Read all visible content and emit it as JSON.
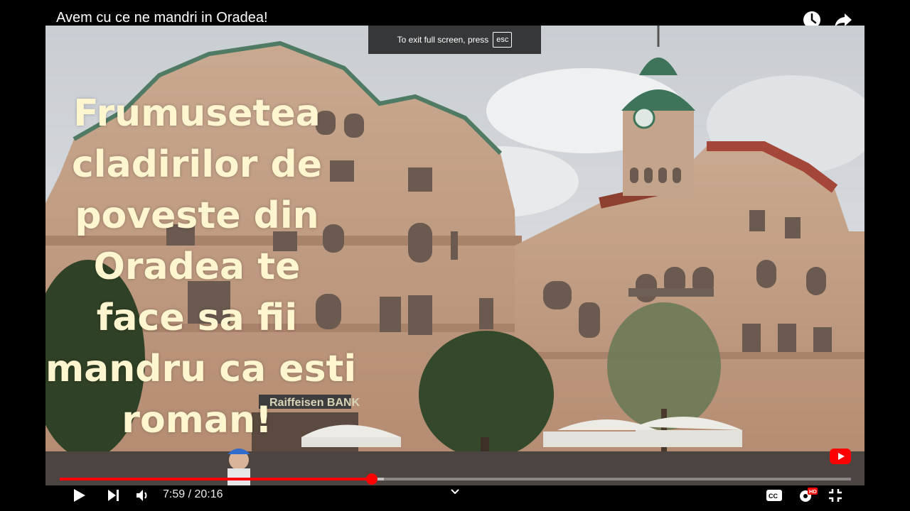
{
  "video": {
    "title": "Avem cu ce ne mandri in Oradea!",
    "overlay_lines": [
      "Frumusetea",
      "cladirilor de",
      "poveste din",
      "Oradea te",
      "face sa fii",
      "mandru ca esti",
      "roman!"
    ],
    "bank_sign": "Raiffeisen BANK"
  },
  "fullscreen_hint": {
    "text": "To exit full screen, press",
    "key": "esc"
  },
  "player": {
    "current_time": "7:59",
    "separator": " / ",
    "duration": "20:16",
    "progress_fraction": 0.394,
    "buffered_fraction": 0.41,
    "quality_badge": "HD",
    "accent_color": "#ff0000"
  },
  "icons": {
    "watch_later": "clock-icon",
    "share": "share-icon",
    "play": "play-icon",
    "next": "next-icon",
    "volume": "volume-icon",
    "chevron": "chevron-down-icon",
    "captions": "captions-icon",
    "settings": "gear-icon",
    "exit_fullscreen": "exit-fullscreen-icon",
    "youtube": "youtube-icon"
  }
}
